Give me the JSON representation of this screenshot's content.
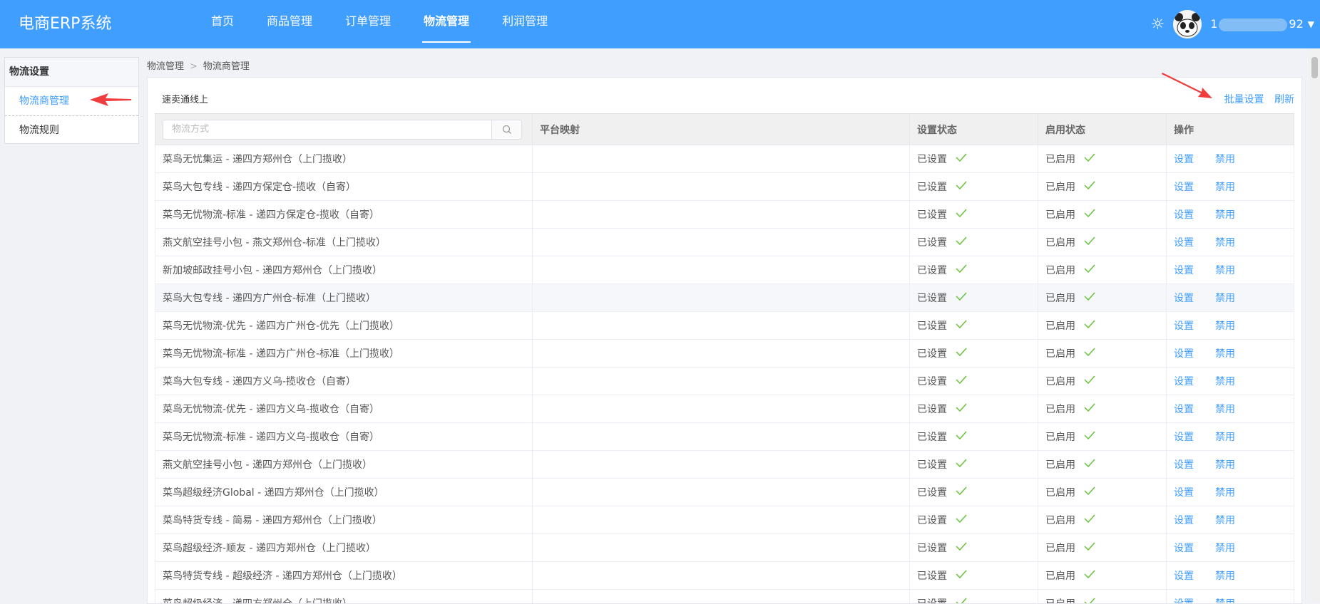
{
  "app": {
    "title": "电商ERP系统"
  },
  "nav": [
    {
      "label": "首页",
      "active": false
    },
    {
      "label": "商品管理",
      "active": false
    },
    {
      "label": "订单管理",
      "active": false
    },
    {
      "label": "物流管理",
      "active": true
    },
    {
      "label": "利润管理",
      "active": false
    }
  ],
  "user": {
    "name_prefix": "1",
    "name_suffix": "92",
    "theme_icon": "sun-icon",
    "caret_icon": "caret-down-icon"
  },
  "sidebar": {
    "title": "物流设置",
    "items": [
      {
        "label": "物流商管理",
        "active": true
      },
      {
        "label": "物流规则",
        "active": false
      }
    ]
  },
  "breadcrumb": {
    "items": [
      "物流管理",
      "物流商管理"
    ],
    "separator": ">"
  },
  "card": {
    "title": "速卖通线上",
    "actions": {
      "batch": "批量设置",
      "refresh": "刷新"
    }
  },
  "table": {
    "search_placeholder": "物流方式",
    "columns": [
      "平台映射",
      "设置状态",
      "启用状态",
      "操作"
    ],
    "rows": [
      {
        "name": "菜鸟无忧集运 - 递四方郑州仓（上门揽收）",
        "mapping": "",
        "set_status": "已设置",
        "enable_status": "已启用",
        "op_set": "设置",
        "op_disable": "禁用"
      },
      {
        "name": "菜鸟大包专线 - 递四方保定仓-揽收（自寄）",
        "mapping": "",
        "set_status": "已设置",
        "enable_status": "已启用",
        "op_set": "设置",
        "op_disable": "禁用"
      },
      {
        "name": "菜鸟无忧物流-标准 - 递四方保定仓-揽收（自寄）",
        "mapping": "",
        "set_status": "已设置",
        "enable_status": "已启用",
        "op_set": "设置",
        "op_disable": "禁用"
      },
      {
        "name": "燕文航空挂号小包 - 燕文郑州仓-标准（上门揽收）",
        "mapping": "",
        "set_status": "已设置",
        "enable_status": "已启用",
        "op_set": "设置",
        "op_disable": "禁用"
      },
      {
        "name": "新加坡邮政挂号小包 - 递四方郑州仓（上门揽收）",
        "mapping": "",
        "set_status": "已设置",
        "enable_status": "已启用",
        "op_set": "设置",
        "op_disable": "禁用"
      },
      {
        "name": "菜鸟大包专线 - 递四方广州仓-标准（上门揽收）",
        "mapping": "",
        "set_status": "已设置",
        "enable_status": "已启用",
        "op_set": "设置",
        "op_disable": "禁用"
      },
      {
        "name": "菜鸟无忧物流-优先 - 递四方广州仓-优先（上门揽收）",
        "mapping": "",
        "set_status": "已设置",
        "enable_status": "已启用",
        "op_set": "设置",
        "op_disable": "禁用"
      },
      {
        "name": "菜鸟无忧物流-标准 - 递四方广州仓-标准（上门揽收）",
        "mapping": "",
        "set_status": "已设置",
        "enable_status": "已启用",
        "op_set": "设置",
        "op_disable": "禁用"
      },
      {
        "name": "菜鸟大包专线 - 递四方义乌-揽收仓（自寄）",
        "mapping": "",
        "set_status": "已设置",
        "enable_status": "已启用",
        "op_set": "设置",
        "op_disable": "禁用"
      },
      {
        "name": "菜鸟无忧物流-优先 - 递四方义乌-揽收仓（自寄）",
        "mapping": "",
        "set_status": "已设置",
        "enable_status": "已启用",
        "op_set": "设置",
        "op_disable": "禁用"
      },
      {
        "name": "菜鸟无忧物流-标准 - 递四方义乌-揽收仓（自寄）",
        "mapping": "",
        "set_status": "已设置",
        "enable_status": "已启用",
        "op_set": "设置",
        "op_disable": "禁用"
      },
      {
        "name": "燕文航空挂号小包 - 递四方郑州仓（上门揽收）",
        "mapping": "",
        "set_status": "已设置",
        "enable_status": "已启用",
        "op_set": "设置",
        "op_disable": "禁用"
      },
      {
        "name": "菜鸟超级经济Global - 递四方郑州仓（上门揽收）",
        "mapping": "",
        "set_status": "已设置",
        "enable_status": "已启用",
        "op_set": "设置",
        "op_disable": "禁用"
      },
      {
        "name": "菜鸟特货专线 - 简易 - 递四方郑州仓（上门揽收）",
        "mapping": "",
        "set_status": "已设置",
        "enable_status": "已启用",
        "op_set": "设置",
        "op_disable": "禁用"
      },
      {
        "name": "菜鸟超级经济-顺友 - 递四方郑州仓（上门揽收）",
        "mapping": "",
        "set_status": "已设置",
        "enable_status": "已启用",
        "op_set": "设置",
        "op_disable": "禁用"
      },
      {
        "name": "菜鸟特货专线 - 超级经济 - 递四方郑州仓（上门揽收）",
        "mapping": "",
        "set_status": "已设置",
        "enable_status": "已启用",
        "op_set": "设置",
        "op_disable": "禁用"
      },
      {
        "name": "菜鸟超级经济 - 递四方郑州仓（上门揽收）",
        "mapping": "",
        "set_status": "已设置",
        "enable_status": "已启用",
        "op_set": "设置",
        "op_disable": "禁用"
      }
    ]
  },
  "colors": {
    "primary": "#409eff",
    "success": "#67c23a",
    "annotation": "#f03c3c"
  },
  "icons": {
    "search": "search-icon",
    "check": "check-icon",
    "sun": "sun-icon",
    "caret": "caret-down-icon"
  }
}
